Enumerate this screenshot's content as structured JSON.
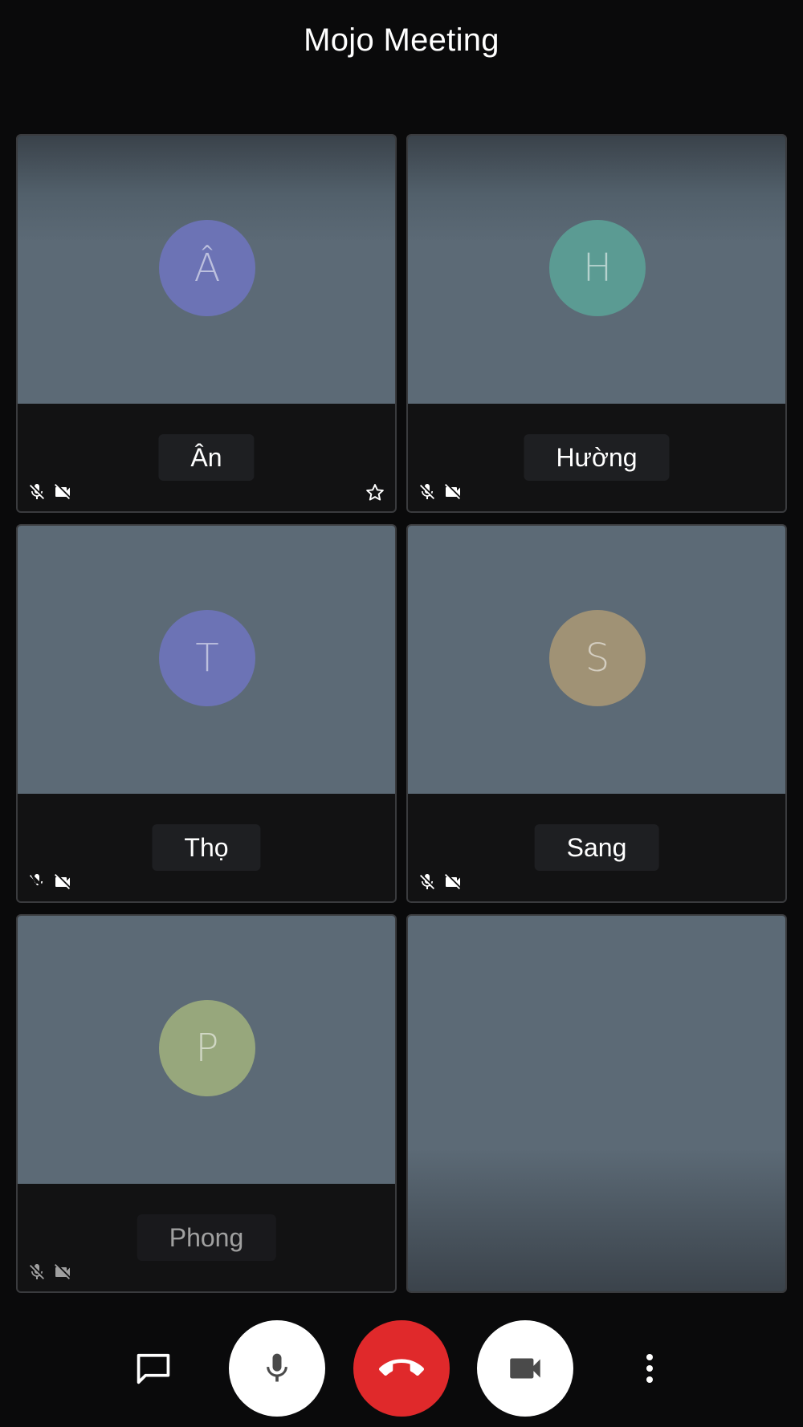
{
  "header": {
    "title": "Mojo Meeting"
  },
  "participants": [
    {
      "initial": "Â",
      "name": "Ân",
      "avatar_color": "#6c73b5",
      "mic_muted": true,
      "camera_off": true,
      "pinned_star": true
    },
    {
      "initial": "H",
      "name": "Hường",
      "avatar_color": "#5b9b93",
      "mic_muted": true,
      "camera_off": true
    },
    {
      "initial": "T",
      "name": "Thọ",
      "avatar_color": "#6c73b5",
      "mic_muted": true,
      "camera_off": true
    },
    {
      "initial": "S",
      "name": "Sang",
      "avatar_color": "#a09275",
      "mic_muted": true,
      "camera_off": true
    },
    {
      "initial": "P",
      "name": "Phong",
      "avatar_color": "#97a77c",
      "mic_muted": true,
      "camera_off": true
    }
  ],
  "controls": {
    "chat_icon": "chat-bubble-icon",
    "mic_icon": "microphone-icon",
    "hangup_icon": "phone-hangup-icon",
    "camera_icon": "video-camera-icon",
    "more_icon": "more-vertical-icon",
    "colors": {
      "hangup": "#e0292b",
      "button": "#ffffff",
      "icon": "#4a4a4a"
    }
  }
}
